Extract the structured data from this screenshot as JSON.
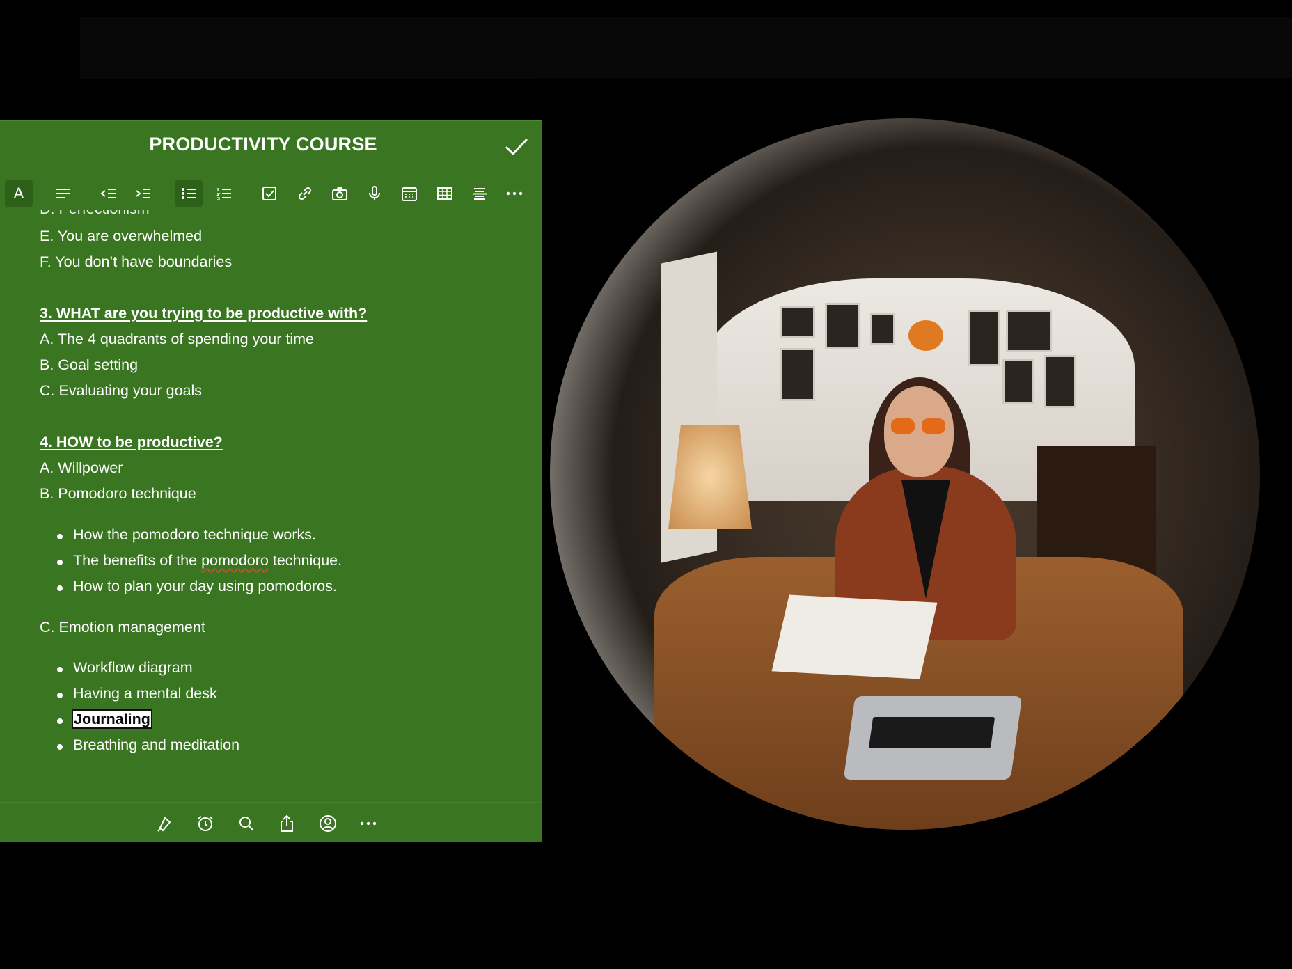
{
  "note": {
    "title": "PRODUCTIVITY COURSE",
    "lines": {
      "cut_top": "D. Perfectionism",
      "e": "E. You are overwhelmed",
      "f": "F. You don’t have boundaries",
      "h3": "3. WHAT are you trying to be productive with?",
      "h3a": "A. The 4 quadrants of spending your time",
      "h3b": "B. Goal setting",
      "h3c": "C. Evaluating your goals",
      "h4": "4. HOW to be productive?",
      "h4a": "A. Willpower",
      "h4b": "B. Pomodoro technique",
      "pom1": "How the pomodoro technique works.",
      "pom2_pre": "The benefits of the ",
      "pom2_word": "pomodoro",
      "pom2_post": " technique.",
      "pom3": "How to plan your day using pomodoros.",
      "h4c": "C. Emotion management",
      "em1": "Workflow diagram",
      "em2": "Having a mental desk",
      "em3": "Journaling",
      "em4": "Breathing and meditation"
    }
  },
  "toolbar": {
    "font_label": "A",
    "items": [
      "font-style",
      "paragraph-style",
      "outdent",
      "indent",
      "bulleted-list",
      "numbered-list",
      "checkbox",
      "link",
      "camera",
      "microphone",
      "calendar",
      "table",
      "strikethrough",
      "more"
    ],
    "active": "bulleted-list"
  },
  "bottom_bar": {
    "items": [
      "highlighter",
      "reminder",
      "search",
      "share",
      "share-note",
      "more"
    ]
  },
  "colors": {
    "note_bg": "#3a7622",
    "highlight_bg": "#ffffff",
    "background": "#000000"
  }
}
